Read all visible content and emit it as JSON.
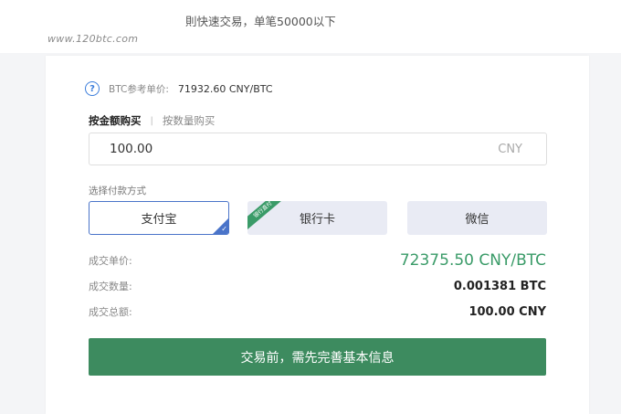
{
  "header": {
    "note": "則快速交易，单笔50000以下",
    "watermark": "www.120btc.com"
  },
  "reference": {
    "label": "BTC参考单价:",
    "value": "71932.60 CNY/BTC",
    "help_icon": "question-circle-icon"
  },
  "buy_mode": {
    "active": "按金额购买",
    "separator": "|",
    "inactive": "按数量购买"
  },
  "amount_input": {
    "value": "100.00",
    "unit": "CNY"
  },
  "payment": {
    "label": "选择付款方式",
    "options": [
      {
        "label": "支付宝",
        "selected": true
      },
      {
        "label": "银行卡",
        "selected": false,
        "badge": "银行直付"
      },
      {
        "label": "微信",
        "selected": false
      }
    ],
    "selected_color": "#4a74c9",
    "badge_color": "#3a9b68"
  },
  "summary": {
    "price_label": "成交单价:",
    "price_value": "72375.50 CNY/BTC",
    "qty_label": "成交数量:",
    "qty_value": "0.001381 BTC",
    "total_label": "成交总额:",
    "total_value": "100.00 CNY"
  },
  "submit_button": {
    "label": "交易前，需先完善基本信息",
    "color": "#3d8b5f"
  }
}
